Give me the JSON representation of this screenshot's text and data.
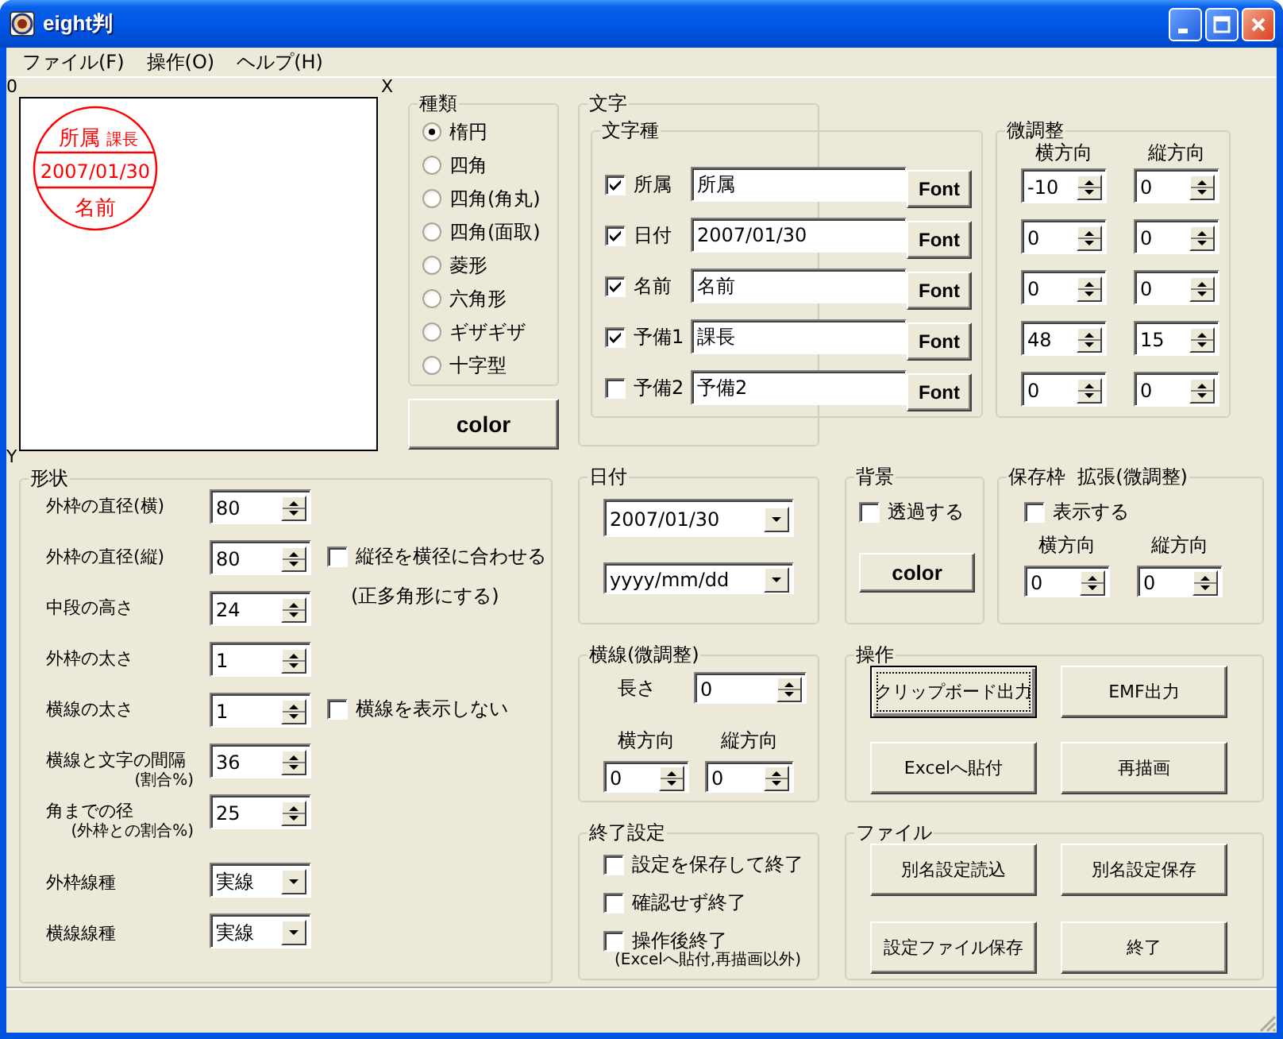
{
  "window": {
    "title": "eight判"
  },
  "menu": [
    {
      "label": "ファイル(F)"
    },
    {
      "label": "操作(O)"
    },
    {
      "label": "ヘルプ(H)"
    }
  ],
  "preview": {
    "origin": "0",
    "x_axis": "X",
    "y_axis": "Y",
    "stamp": {
      "top": "所属",
      "top_extra": "課長",
      "middle": "2007/01/30",
      "bottom": "名前"
    }
  },
  "shape_type": {
    "title": "種類",
    "options": [
      {
        "label": "楕円",
        "selected": true
      },
      {
        "label": "四角",
        "selected": false
      },
      {
        "label": "四角(角丸)",
        "selected": false
      },
      {
        "label": "四角(面取)",
        "selected": false
      },
      {
        "label": "菱形",
        "selected": false
      },
      {
        "label": "六角形",
        "selected": false
      },
      {
        "label": "ギザギザ",
        "selected": false
      },
      {
        "label": "十字型",
        "selected": false
      }
    ]
  },
  "color_button": "color",
  "text": {
    "title": "文字",
    "kinds": {
      "title": "文字種",
      "rows": [
        {
          "label": "所属",
          "checked": true,
          "value": "所属",
          "button": "Font"
        },
        {
          "label": "日付",
          "checked": true,
          "value": "2007/01/30",
          "button": "Font"
        },
        {
          "label": "名前",
          "checked": true,
          "value": "名前",
          "button": "Font"
        },
        {
          "label": "予備1",
          "checked": true,
          "value": "課長",
          "button": "Font"
        },
        {
          "label": "予備2",
          "checked": false,
          "value": "予備2",
          "button": "Font"
        }
      ]
    },
    "adjust": {
      "title": "微調整",
      "columns": [
        "横方向",
        "縦方向"
      ],
      "rows": [
        [
          "-10",
          "0"
        ],
        [
          "0",
          "0"
        ],
        [
          "0",
          "0"
        ],
        [
          "48",
          "15"
        ],
        [
          "0",
          "0"
        ]
      ]
    }
  },
  "shape": {
    "title": "形状",
    "rows": [
      {
        "kind": "spin",
        "label": "外枠の直径(横)",
        "value": "80"
      },
      {
        "kind": "spin",
        "label": "外枠の直径(縦)",
        "value": "80",
        "option": {
          "label": "縦径を横径に合わせる",
          "checked": false,
          "note": "(正多角形にする)"
        }
      },
      {
        "kind": "spin",
        "label": "中段の高さ",
        "value": "24"
      },
      {
        "kind": "spin",
        "label": "外枠の太さ",
        "value": "1"
      },
      {
        "kind": "spin",
        "label": "横線の太さ",
        "value": "1",
        "option": {
          "label": "横線を表示しない",
          "checked": false
        }
      },
      {
        "kind": "spin",
        "label": "横線と文字の間隔",
        "sublabel": "(割合%)",
        "value": "36"
      },
      {
        "kind": "spin",
        "label": "角までの径",
        "sublabel": "(外枠との割合%)",
        "value": "25"
      },
      {
        "kind": "combo",
        "label": "外枠線種",
        "value": "実線"
      },
      {
        "kind": "combo",
        "label": "横線線種",
        "value": "実線"
      }
    ]
  },
  "date": {
    "title": "日付",
    "value": "2007/01/30",
    "format": "yyyy/mm/dd"
  },
  "background": {
    "title": "背景",
    "transparent": {
      "label": "透過する",
      "checked": false
    },
    "button": "color"
  },
  "save_frame": {
    "title": "保存枠  拡張(微調整)",
    "show": {
      "label": "表示する",
      "checked": false
    },
    "columns": [
      "横方向",
      "縦方向"
    ],
    "values": [
      "0",
      "0"
    ]
  },
  "hline": {
    "title": "横線(微調整)",
    "length_label": "長さ",
    "length": "0",
    "columns": [
      "横方向",
      "縦方向"
    ],
    "values": [
      "0",
      "0"
    ]
  },
  "operations": {
    "title": "操作",
    "buttons": [
      {
        "label": "クリップボード出力",
        "focused": true
      },
      {
        "label": "EMF出力",
        "focused": false
      },
      {
        "label": "Excelへ貼付",
        "focused": false
      },
      {
        "label": "再描画",
        "focused": false
      }
    ]
  },
  "exit": {
    "title": "終了設定",
    "options": [
      {
        "label": "設定を保存して終了",
        "checked": false
      },
      {
        "label": "確認せず終了",
        "checked": false
      },
      {
        "label": "操作後終了",
        "checked": false,
        "note": "(Excelへ貼付,再描画以外)"
      }
    ]
  },
  "file": {
    "title": "ファイル",
    "buttons": [
      "別名設定読込",
      "別名設定保存",
      "設定ファイル保存",
      "終了"
    ]
  }
}
